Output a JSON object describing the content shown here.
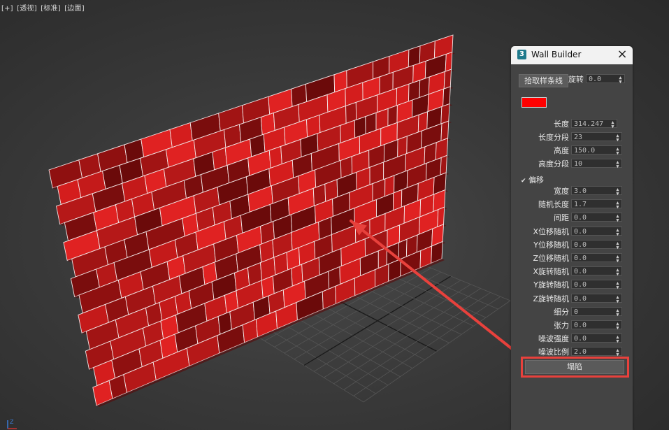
{
  "viewport": {
    "labels": [
      "[+]",
      "[透视]",
      "[标准]",
      "[边面]"
    ]
  },
  "scene": {
    "brick_colors": [
      "#7a0d0d",
      "#a11414",
      "#c41a1a",
      "#e02222",
      "#8f1010",
      "#b51818",
      "#d41d1d",
      "#6b0a0a"
    ],
    "grout_color": "#f2e6e6",
    "grid_color": "#555555",
    "annotation_color": "#e8413c"
  },
  "panel": {
    "title": "Wall Builder",
    "app_icon": "3",
    "close_icon": "×",
    "pick_spline_label": "拾取样条线",
    "rotation_label": "旋转",
    "rotation_value": "0.0",
    "color_swatch": "#ff0000",
    "params": [
      {
        "label": "长度",
        "value": "314.247"
      },
      {
        "label": "长度分段",
        "value": "23"
      },
      {
        "label": "高度",
        "value": "150.0"
      },
      {
        "label": "高度分段",
        "value": "10"
      }
    ],
    "offset_checkbox": {
      "label": "偏移",
      "checked": true,
      "mark": "✔"
    },
    "params2": [
      {
        "label": "宽度",
        "value": "3.0"
      },
      {
        "label": "随机长度",
        "value": "1.7"
      },
      {
        "label": "间距",
        "value": "0.0"
      },
      {
        "label": "X位移随机",
        "value": "0.0"
      },
      {
        "label": "Y位移随机",
        "value": "0.0"
      },
      {
        "label": "Z位移随机",
        "value": "0.0"
      },
      {
        "label": "X旋转随机",
        "value": "0.0"
      },
      {
        "label": "Y旋转随机",
        "value": "0.0"
      },
      {
        "label": "Z旋转随机",
        "value": "0.0"
      },
      {
        "label": "细分",
        "value": "0"
      },
      {
        "label": "张力",
        "value": "0.0"
      },
      {
        "label": "噪波强度",
        "value": "0.0"
      },
      {
        "label": "噪波比例",
        "value": "2.0"
      }
    ],
    "collapse_label": "塌陷"
  },
  "gizmo": {
    "axis_label": "Z"
  }
}
